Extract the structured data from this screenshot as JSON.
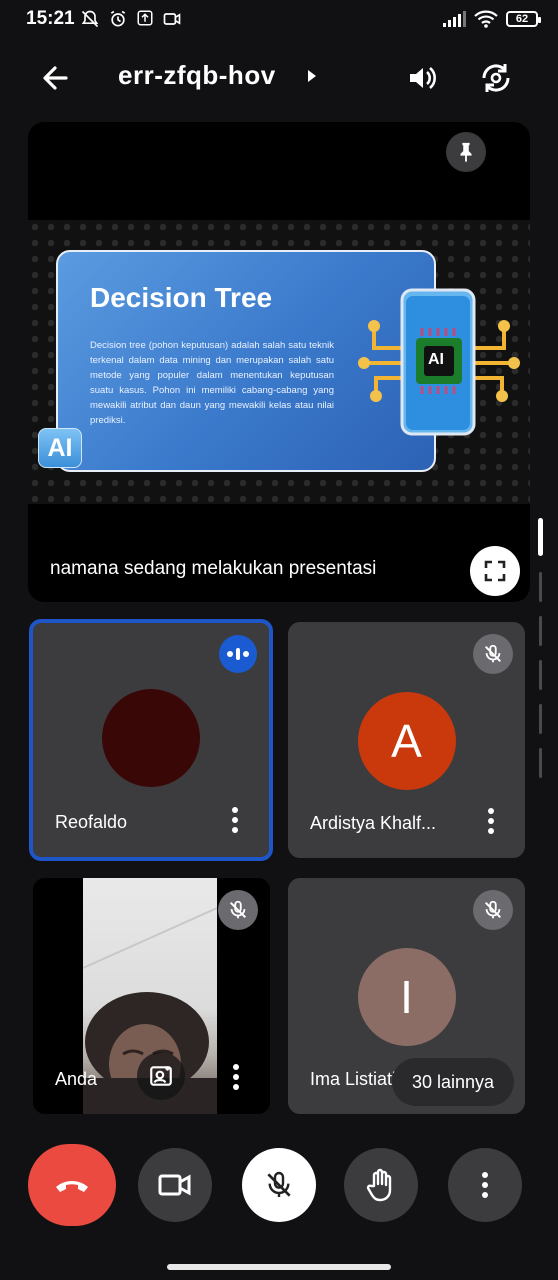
{
  "status_bar": {
    "time": "15:21",
    "battery": "62",
    "icons_left": [
      "bell-off-icon",
      "alarm-icon",
      "upload-icon",
      "video-cam-icon"
    ],
    "icons_right": [
      "signal-icon",
      "wifi-icon",
      "battery-icon"
    ]
  },
  "appbar": {
    "meeting_code": "err-zfqb-hov",
    "icons": [
      "back-arrow-icon",
      "caret-right-icon",
      "speaker-icon",
      "flip-camera-icon"
    ]
  },
  "presentation": {
    "slide_title": "Decision Tree",
    "slide_body": "Decision tree (pohon keputusan) adalah salah satu teknik terkenal dalam data mining dan merupakan salah satu metode yang populer dalam menentukan keputusan suatu kasus. Pohon ini memiliki cabang-cabang yang mewakili atribut dan daun yang mewakili kelas atau nilai prediksi.",
    "slide_badge": "AI",
    "phone_chip_label": "AI",
    "caption": "namana sedang melakukan presentasi"
  },
  "participants": [
    {
      "name": "Reofaldo",
      "avatar_letter": "",
      "avatar_color": "#3a0707",
      "state": "speaking"
    },
    {
      "name": "Ardistya Khalf...",
      "avatar_letter": "A",
      "avatar_color": "#c9390c",
      "state": "muted"
    },
    {
      "name": "Anda",
      "avatar_letter": "",
      "avatar_color": "",
      "state": "muted-camera-on"
    },
    {
      "name": "Ima Listiati",
      "avatar_letter": "I",
      "avatar_color": "#8c6d66",
      "state": "muted"
    }
  ],
  "more_participants": "30 lainnya",
  "controls": {
    "end_call_color": "#ea4a3f",
    "buttons": [
      "end-call",
      "video",
      "mic-off",
      "raise-hand",
      "more-options"
    ]
  },
  "accent_colors": {
    "active_speaker_border": "#1e56c7",
    "tile_bg": "#3c3c3f",
    "app_bg": "#111113"
  }
}
